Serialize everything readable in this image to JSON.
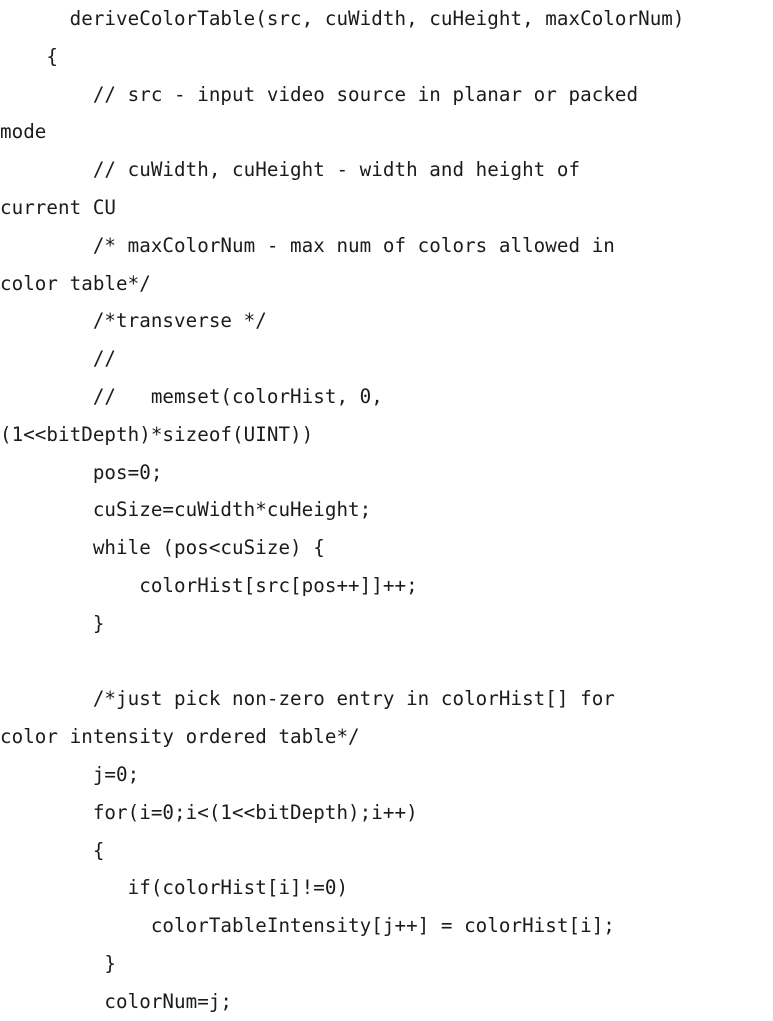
{
  "document": {
    "kind": "code-listing",
    "language": "c",
    "background_color": "#ffffff",
    "text_color": "#1b1b1b",
    "font_style": "monospace-typewriter",
    "line_count": 24
  },
  "code": {
    "lines": [
      "      deriveColorTable(src, cuWidth, cuHeight, maxColorNum)",
      "    {",
      "        // src - input video source in planar or packed",
      "mode",
      "        // cuWidth, cuHeight - width and height of",
      "current CU",
      "        /* maxColorNum - max num of colors allowed in",
      "color table*/",
      "        /*transverse */",
      "        //",
      "        //   memset(colorHist, 0,",
      "(1<<bitDepth)*sizeof(UINT))",
      "        pos=0;",
      "        cuSize=cuWidth*cuHeight;",
      "        while (pos<cuSize) {",
      "            colorHist[src[pos++]]++;",
      "        }",
      "",
      "        /*just pick non-zero entry in colorHist[] for",
      "color intensity ordered table*/",
      "        j=0;",
      "        for(i=0;i<(1<<bitDepth);i++)",
      "        {",
      "           if(colorHist[i]!=0)",
      "             colorTableIntensity[j++] = colorHist[i];",
      "         }",
      "         colorNum=j;"
    ]
  }
}
